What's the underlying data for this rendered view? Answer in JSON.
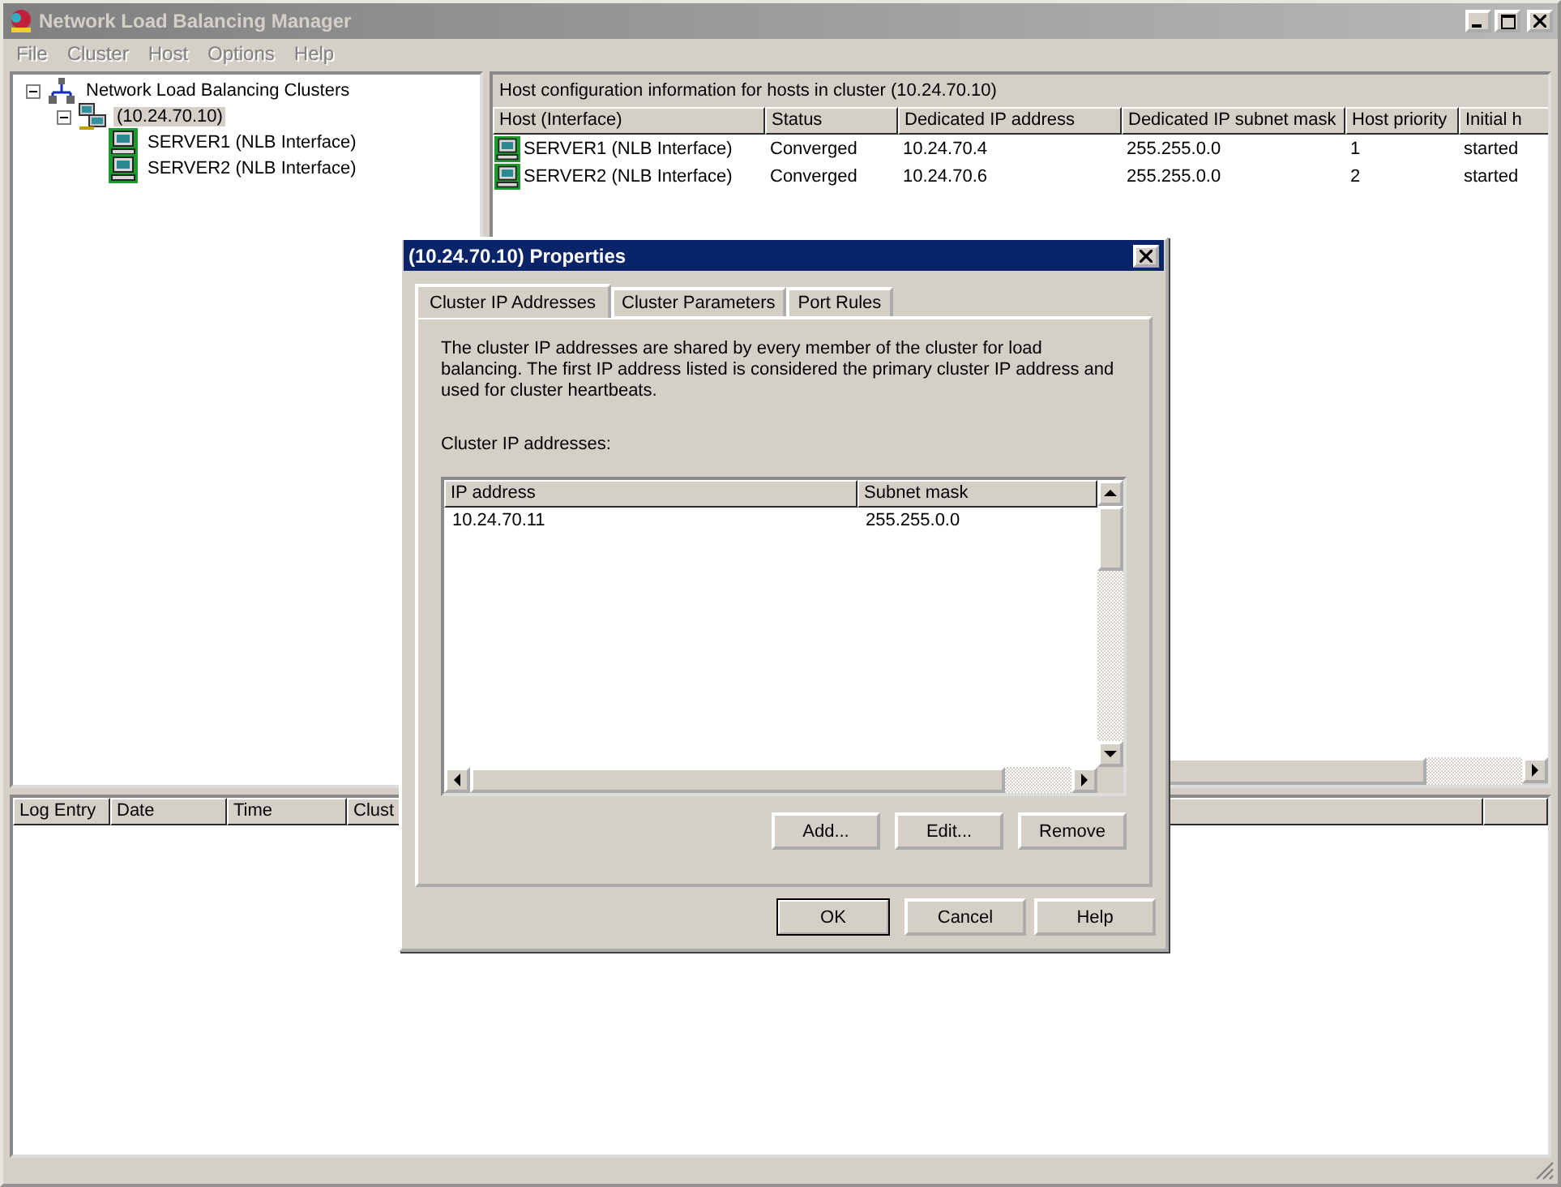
{
  "window": {
    "title": "Network Load Balancing Manager",
    "active": false
  },
  "menu": [
    {
      "label": "File",
      "disabled": true
    },
    {
      "label": "Cluster",
      "disabled": true
    },
    {
      "label": "Host",
      "disabled": true
    },
    {
      "label": "Options",
      "disabled": true
    },
    {
      "label": "Help",
      "disabled": true
    }
  ],
  "tree": [
    {
      "label": "Network Load Balancing Clusters",
      "kind": "clusters",
      "expanded": true,
      "selected": false,
      "children": [
        {
          "label": "(10.24.70.10)",
          "kind": "cluster",
          "expanded": true,
          "selected": true,
          "children": [
            {
              "label": "SERVER1 (NLB Interface)",
              "kind": "host",
              "selected": false
            },
            {
              "label": "SERVER2 (NLB Interface)",
              "kind": "host",
              "selected": false
            }
          ]
        }
      ]
    }
  ],
  "hosts": {
    "caption": "Host configuration information for hosts in cluster  (10.24.70.10)",
    "columns": [
      "Host (Interface)",
      "Status",
      "Dedicated IP address",
      "Dedicated IP subnet mask",
      "Host priority",
      "Initial h"
    ],
    "rows": [
      [
        "SERVER1 (NLB Interface)",
        "Converged",
        "10.24.70.4",
        "255.255.0.0",
        "1",
        "started"
      ],
      [
        "SERVER2 (NLB Interface)",
        "Converged",
        "10.24.70.6",
        "255.255.0.0",
        "2",
        "started"
      ]
    ]
  },
  "log": {
    "columns": [
      "Log Entry",
      "Date",
      "Time",
      "Clust"
    ]
  },
  "dialog": {
    "title": "(10.24.70.10) Properties",
    "tabs": [
      {
        "label": "Cluster IP Addresses",
        "selected": true
      },
      {
        "label": "Cluster Parameters",
        "selected": false
      },
      {
        "label": "Port Rules",
        "selected": false
      }
    ],
    "description": "The cluster IP addresses are shared by every member of the cluster for load balancing. The first IP address listed is considered the primary cluster IP address and used for cluster heartbeats.",
    "list_label": "Cluster IP addresses:",
    "list": {
      "columns": [
        "IP address",
        "Subnet mask"
      ],
      "rows": [
        [
          "10.24.70.11",
          "255.255.0.0"
        ]
      ]
    },
    "buttons": [
      "Add...",
      "Edit...",
      "Remove"
    ],
    "footer_buttons": [
      {
        "label": "OK",
        "default": true
      },
      {
        "label": "Cancel",
        "default": false
      },
      {
        "label": "Help",
        "default": false
      }
    ]
  }
}
